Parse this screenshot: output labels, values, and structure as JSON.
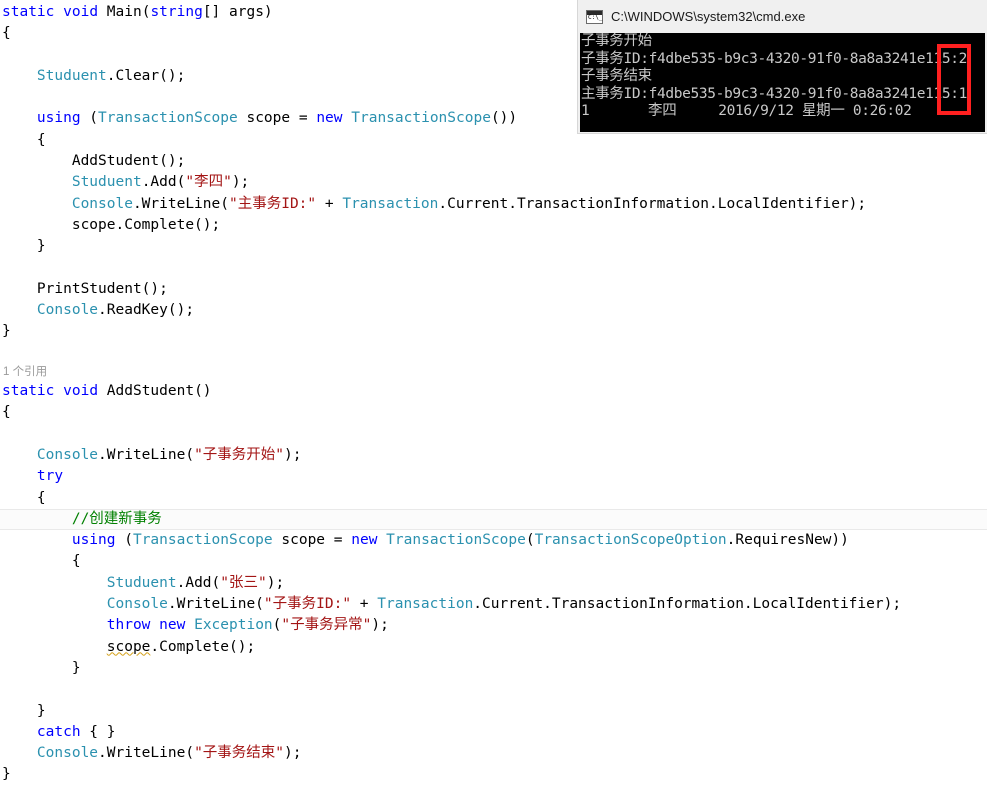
{
  "editor": {
    "codelens_label": "1 个引用",
    "lines": [
      {
        "id": "l1",
        "indent": 0,
        "tokens": [
          {
            "c": "kw",
            "t": "static"
          },
          {
            "c": "plain",
            "t": " "
          },
          {
            "c": "kw",
            "t": "void"
          },
          {
            "c": "plain",
            "t": " Main("
          },
          {
            "c": "kw",
            "t": "string"
          },
          {
            "c": "plain",
            "t": "[] args)"
          }
        ]
      },
      {
        "id": "l2",
        "indent": 0,
        "tokens": [
          {
            "c": "plain",
            "t": "{"
          }
        ]
      },
      {
        "id": "l3",
        "indent": 0,
        "tokens": []
      },
      {
        "id": "l4",
        "indent": 0,
        "tokens": [
          {
            "c": "plain",
            "t": "    "
          },
          {
            "c": "type",
            "t": "Studuent"
          },
          {
            "c": "plain",
            "t": ".Clear();"
          }
        ]
      },
      {
        "id": "l5",
        "indent": 0,
        "tokens": []
      },
      {
        "id": "l6",
        "indent": 0,
        "tokens": [
          {
            "c": "plain",
            "t": "    "
          },
          {
            "c": "kw",
            "t": "using"
          },
          {
            "c": "plain",
            "t": " ("
          },
          {
            "c": "type",
            "t": "TransactionScope"
          },
          {
            "c": "plain",
            "t": " scope = "
          },
          {
            "c": "kw",
            "t": "new"
          },
          {
            "c": "plain",
            "t": " "
          },
          {
            "c": "type",
            "t": "TransactionScope"
          },
          {
            "c": "plain",
            "t": "())"
          }
        ]
      },
      {
        "id": "l7",
        "indent": 0,
        "tokens": [
          {
            "c": "plain",
            "t": "    {"
          }
        ]
      },
      {
        "id": "l8",
        "indent": 0,
        "tokens": [
          {
            "c": "plain",
            "t": "        AddStudent();"
          }
        ]
      },
      {
        "id": "l9",
        "indent": 0,
        "tokens": [
          {
            "c": "plain",
            "t": "        "
          },
          {
            "c": "type",
            "t": "Studuent"
          },
          {
            "c": "plain",
            "t": ".Add("
          },
          {
            "c": "str",
            "t": "\"李四\""
          },
          {
            "c": "plain",
            "t": ");"
          }
        ]
      },
      {
        "id": "l10",
        "indent": 0,
        "tokens": [
          {
            "c": "plain",
            "t": "        "
          },
          {
            "c": "type",
            "t": "Console"
          },
          {
            "c": "plain",
            "t": ".WriteLine("
          },
          {
            "c": "str",
            "t": "\"主事务ID:\""
          },
          {
            "c": "plain",
            "t": " + "
          },
          {
            "c": "type",
            "t": "Transaction"
          },
          {
            "c": "plain",
            "t": ".Current.TransactionInformation.LocalIdentifier);"
          }
        ]
      },
      {
        "id": "l11",
        "indent": 0,
        "tokens": [
          {
            "c": "plain",
            "t": "        scope.Complete();"
          }
        ]
      },
      {
        "id": "l12",
        "indent": 0,
        "tokens": [
          {
            "c": "plain",
            "t": "    }"
          }
        ]
      },
      {
        "id": "l13",
        "indent": 0,
        "tokens": []
      },
      {
        "id": "l14",
        "indent": 0,
        "tokens": [
          {
            "c": "plain",
            "t": "    PrintStudent();"
          }
        ]
      },
      {
        "id": "l15",
        "indent": 0,
        "tokens": [
          {
            "c": "plain",
            "t": "    "
          },
          {
            "c": "type",
            "t": "Console"
          },
          {
            "c": "plain",
            "t": ".ReadKey();"
          }
        ]
      },
      {
        "id": "l16",
        "indent": 0,
        "tokens": [
          {
            "c": "plain",
            "t": "}"
          }
        ]
      },
      {
        "id": "l17",
        "indent": 0,
        "tokens": []
      },
      {
        "id": "codelens",
        "codelens": true,
        "tokens": []
      },
      {
        "id": "l18",
        "indent": 0,
        "tokens": [
          {
            "c": "kw",
            "t": "static"
          },
          {
            "c": "plain",
            "t": " "
          },
          {
            "c": "kw",
            "t": "void"
          },
          {
            "c": "plain",
            "t": " AddStudent()"
          }
        ]
      },
      {
        "id": "l19",
        "indent": 0,
        "tokens": [
          {
            "c": "plain",
            "t": "{"
          }
        ]
      },
      {
        "id": "l20",
        "indent": 0,
        "tokens": []
      },
      {
        "id": "l21",
        "indent": 0,
        "tokens": [
          {
            "c": "plain",
            "t": "    "
          },
          {
            "c": "type",
            "t": "Console"
          },
          {
            "c": "plain",
            "t": ".WriteLine("
          },
          {
            "c": "str",
            "t": "\"子事务开始\""
          },
          {
            "c": "plain",
            "t": ");"
          }
        ]
      },
      {
        "id": "l22",
        "indent": 0,
        "tokens": [
          {
            "c": "plain",
            "t": "    "
          },
          {
            "c": "kw",
            "t": "try"
          }
        ]
      },
      {
        "id": "l23",
        "indent": 0,
        "tokens": [
          {
            "c": "plain",
            "t": "    {"
          }
        ]
      },
      {
        "id": "l24",
        "indent": 0,
        "current": true,
        "tokens": [
          {
            "c": "plain",
            "t": "        "
          },
          {
            "c": "cmt",
            "t": "//创建新事务"
          }
        ]
      },
      {
        "id": "l25",
        "indent": 0,
        "tokens": [
          {
            "c": "plain",
            "t": "        "
          },
          {
            "c": "kw",
            "t": "using"
          },
          {
            "c": "plain",
            "t": " ("
          },
          {
            "c": "type",
            "t": "TransactionScope"
          },
          {
            "c": "plain",
            "t": " scope = "
          },
          {
            "c": "kw",
            "t": "new"
          },
          {
            "c": "plain",
            "t": " "
          },
          {
            "c": "type",
            "t": "TransactionScope"
          },
          {
            "c": "plain",
            "t": "("
          },
          {
            "c": "type",
            "t": "TransactionScopeOption"
          },
          {
            "c": "plain",
            "t": ".RequiresNew))"
          }
        ]
      },
      {
        "id": "l26",
        "indent": 0,
        "tokens": [
          {
            "c": "plain",
            "t": "        {"
          }
        ]
      },
      {
        "id": "l27",
        "indent": 0,
        "tokens": [
          {
            "c": "plain",
            "t": "            "
          },
          {
            "c": "type",
            "t": "Studuent"
          },
          {
            "c": "plain",
            "t": ".Add("
          },
          {
            "c": "str",
            "t": "\"张三\""
          },
          {
            "c": "plain",
            "t": ");"
          }
        ]
      },
      {
        "id": "l28",
        "indent": 0,
        "tokens": [
          {
            "c": "plain",
            "t": "            "
          },
          {
            "c": "type",
            "t": "Console"
          },
          {
            "c": "plain",
            "t": ".WriteLine("
          },
          {
            "c": "str",
            "t": "\"子事务ID:\""
          },
          {
            "c": "plain",
            "t": " + "
          },
          {
            "c": "type",
            "t": "Transaction"
          },
          {
            "c": "plain",
            "t": ".Current.TransactionInformation.LocalIdentifier);"
          }
        ]
      },
      {
        "id": "l29",
        "indent": 0,
        "tokens": [
          {
            "c": "plain",
            "t": "            "
          },
          {
            "c": "kw",
            "t": "throw"
          },
          {
            "c": "plain",
            "t": " "
          },
          {
            "c": "kw",
            "t": "new"
          },
          {
            "c": "plain",
            "t": " "
          },
          {
            "c": "type",
            "t": "Exception"
          },
          {
            "c": "plain",
            "t": "("
          },
          {
            "c": "str",
            "t": "\"子事务异常\""
          },
          {
            "c": "plain",
            "t": ");"
          }
        ]
      },
      {
        "id": "l30",
        "indent": 0,
        "tokens": [
          {
            "c": "plain",
            "t": "            "
          },
          {
            "c": "squiggle",
            "t": "scope"
          },
          {
            "c": "plain",
            "t": ".Complete();"
          }
        ]
      },
      {
        "id": "l31",
        "indent": 0,
        "tokens": [
          {
            "c": "plain",
            "t": "        }"
          }
        ]
      },
      {
        "id": "l32",
        "indent": 0,
        "tokens": []
      },
      {
        "id": "l33",
        "indent": 0,
        "tokens": [
          {
            "c": "plain",
            "t": "    }"
          }
        ]
      },
      {
        "id": "l34",
        "indent": 0,
        "tokens": [
          {
            "c": "plain",
            "t": "    "
          },
          {
            "c": "kw",
            "t": "catch"
          },
          {
            "c": "plain",
            "t": " { }"
          }
        ]
      },
      {
        "id": "l35",
        "indent": 0,
        "tokens": [
          {
            "c": "plain",
            "t": "    "
          },
          {
            "c": "type",
            "t": "Console"
          },
          {
            "c": "plain",
            "t": ".WriteLine("
          },
          {
            "c": "str",
            "t": "\"子事务结束\""
          },
          {
            "c": "plain",
            "t": ");"
          }
        ]
      },
      {
        "id": "l36",
        "indent": 0,
        "tokens": [
          {
            "c": "plain",
            "t": "}"
          }
        ]
      }
    ]
  },
  "console_window": {
    "title": "C:\\WINDOWS\\system32\\cmd.exe",
    "icon": "cmd-icon",
    "output_lines": [
      "子事务开始",
      "子事务ID:f4dbe535-b9c3-4320-91f0-8a8a3241e115:2",
      "子事务结束",
      "主事务ID:f4dbe535-b9c3-4320-91f0-8a8a3241e115:1",
      "1       李四     2016/9/12 星期一 0:26:02"
    ]
  },
  "annotation": {
    "type": "red-rectangle-highlight",
    "color": "#ff2020"
  },
  "colors": {
    "keyword": "#0000ff",
    "type": "#2b91af",
    "string": "#a31515",
    "comment": "#008000",
    "plain": "#000000",
    "codelens": "#9a9a9a",
    "console_bg": "#000000",
    "console_fg": "#c8c8c8",
    "titlebar_bg": "#f0f0f0",
    "annotation": "#ff2020"
  }
}
